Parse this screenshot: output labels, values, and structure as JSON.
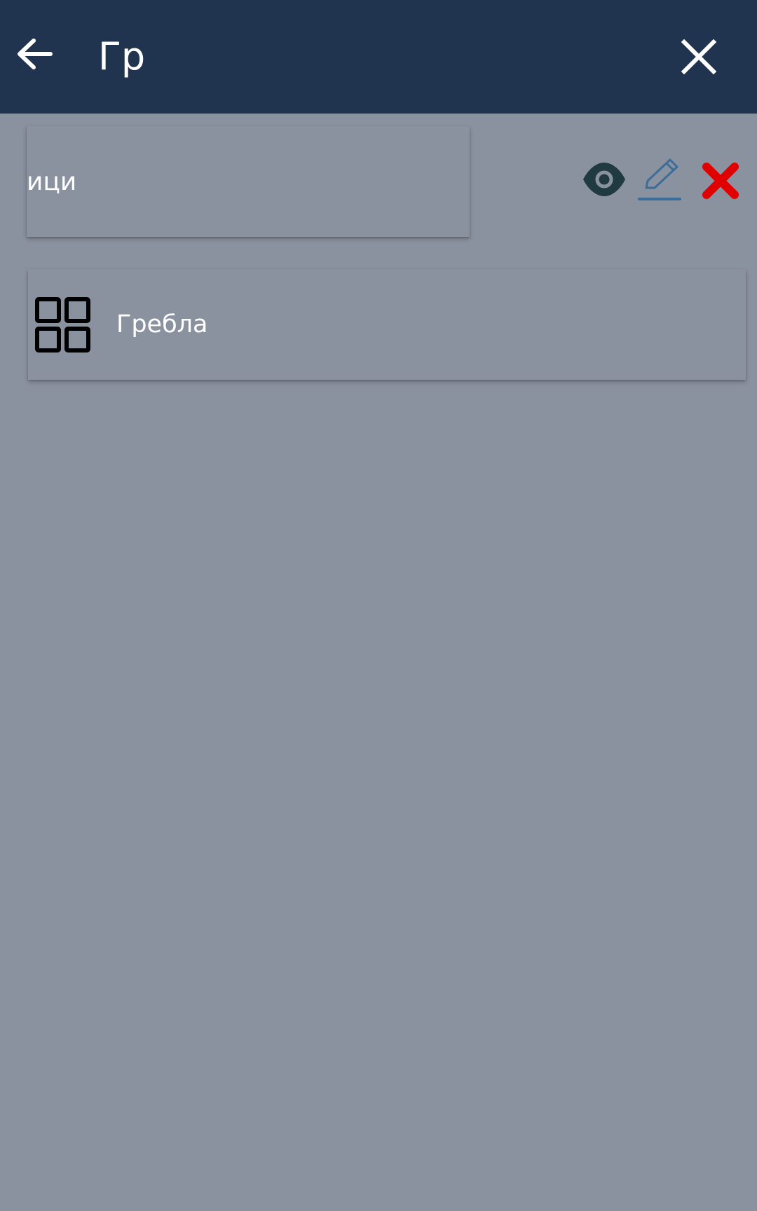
{
  "appbar": {
    "search_query": "Гр",
    "back_icon": "arrow-left-icon",
    "close_icon": "close-icon",
    "background_color": "#21344f"
  },
  "swiped_row": {
    "label": "ици",
    "actions": [
      {
        "icon": "eye-icon",
        "color": "#1f3a40"
      },
      {
        "icon": "pencil-icon",
        "color": "#3a6d9a"
      },
      {
        "icon": "red-x-icon",
        "color": "#e00000"
      }
    ]
  },
  "results": [
    {
      "label": "Гребла",
      "icon": "grid-icon"
    }
  ],
  "colors": {
    "overlay_background": "#8b929f",
    "text": "#ffffff"
  }
}
